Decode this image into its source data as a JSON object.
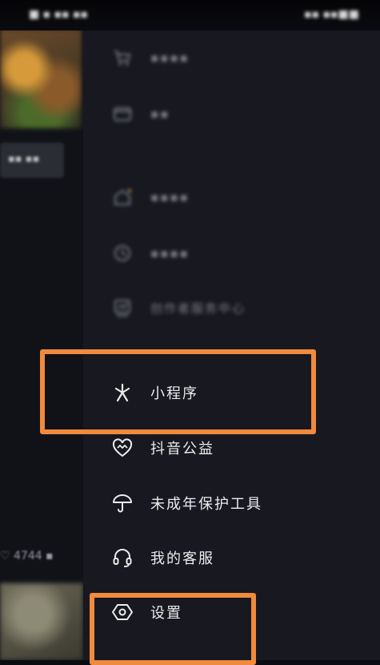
{
  "status_bar": {
    "left_text": "■ ▪ ▪▪ ▪▪",
    "right_text": "▪▪ ▪▪■■"
  },
  "background": {
    "tag_text": "▪▪ ▪▪",
    "likes_count": "4744"
  },
  "drawer": {
    "items": [
      {
        "label": "▪▪▪▪",
        "icon": "cart-icon",
        "blurred": true
      },
      {
        "label": "▪▪",
        "icon": "wallet-icon",
        "blurred": true
      },
      {
        "label": "▪▪▪▪",
        "icon": "home-icon",
        "blurred": true
      },
      {
        "label": "▪▪▪▪",
        "icon": "clock-icon",
        "blurred": true
      },
      {
        "label": "创作者服务中心",
        "icon": "creator-icon",
        "blurred": true
      },
      {
        "label": "小程序",
        "icon": "mini-program-icon",
        "blurred": false
      },
      {
        "label": "抖音公益",
        "icon": "charity-heart-icon",
        "blurred": false
      },
      {
        "label": "未成年保护工具",
        "icon": "umbrella-icon",
        "blurred": false
      },
      {
        "label": "我的客服",
        "icon": "headset-icon",
        "blurred": false
      },
      {
        "label": "设置",
        "icon": "settings-icon",
        "blurred": false
      }
    ]
  },
  "colors": {
    "highlight": "#f08a3c",
    "drawer_bg": "#171820",
    "text": "#ececec"
  }
}
